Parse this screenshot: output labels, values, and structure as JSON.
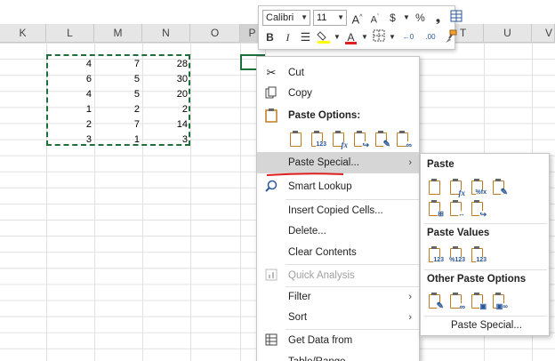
{
  "columns": [
    "K",
    "L",
    "M",
    "N",
    "O",
    "P",
    "T",
    "U",
    "V"
  ],
  "cells": [
    [
      "4",
      "7",
      "28"
    ],
    [
      "6",
      "5",
      "30"
    ],
    [
      "4",
      "5",
      "20"
    ],
    [
      "1",
      "2",
      "2"
    ],
    [
      "2",
      "7",
      "14"
    ],
    [
      "3",
      "1",
      "3"
    ]
  ],
  "mini_toolbar": {
    "font_name": "Calibri",
    "font_size": "11",
    "grow_font": "A",
    "shrink_font": "A",
    "currency": "$",
    "percent": "%",
    "comma": "❟",
    "bold": "B",
    "italic": "I",
    "font_color_letter": "A",
    "inc_decimal": "←0",
    "dec_decimal": ".00",
    "decimal_tail": ".0"
  },
  "menu": {
    "cut": "Cut",
    "copy": "Copy",
    "paste_options": "Paste Options:",
    "paste_special": "Paste Special...",
    "smart_lookup": "Smart Lookup",
    "insert_copied": "Insert Copied Cells...",
    "delete": "Delete...",
    "clear_contents": "Clear Contents",
    "quick_analysis": "Quick Analysis",
    "filter": "Filter",
    "sort": "Sort",
    "get_data": "Get Data from Table/Range..."
  },
  "paste_icon_badges": [
    "",
    "123",
    "fx",
    "",
    "",
    ""
  ],
  "submenu": {
    "paste": "Paste",
    "paste_values": "Paste Values",
    "other_paste_options": "Other Paste Options",
    "paste_special_link": "Paste Special...",
    "paste_badges": [
      "",
      "fx",
      "%fx",
      ""
    ],
    "paste_badges_row2": [
      "",
      "",
      ""
    ],
    "values_badges": [
      "123",
      "%123",
      "123"
    ],
    "other_badges": [
      "",
      "",
      "",
      ""
    ]
  },
  "colors": {
    "accent_green": "#1e6e3a",
    "clip_orange": "#c07a1e",
    "highlight": "#d6d6d6",
    "red_underline": "#e02020"
  }
}
